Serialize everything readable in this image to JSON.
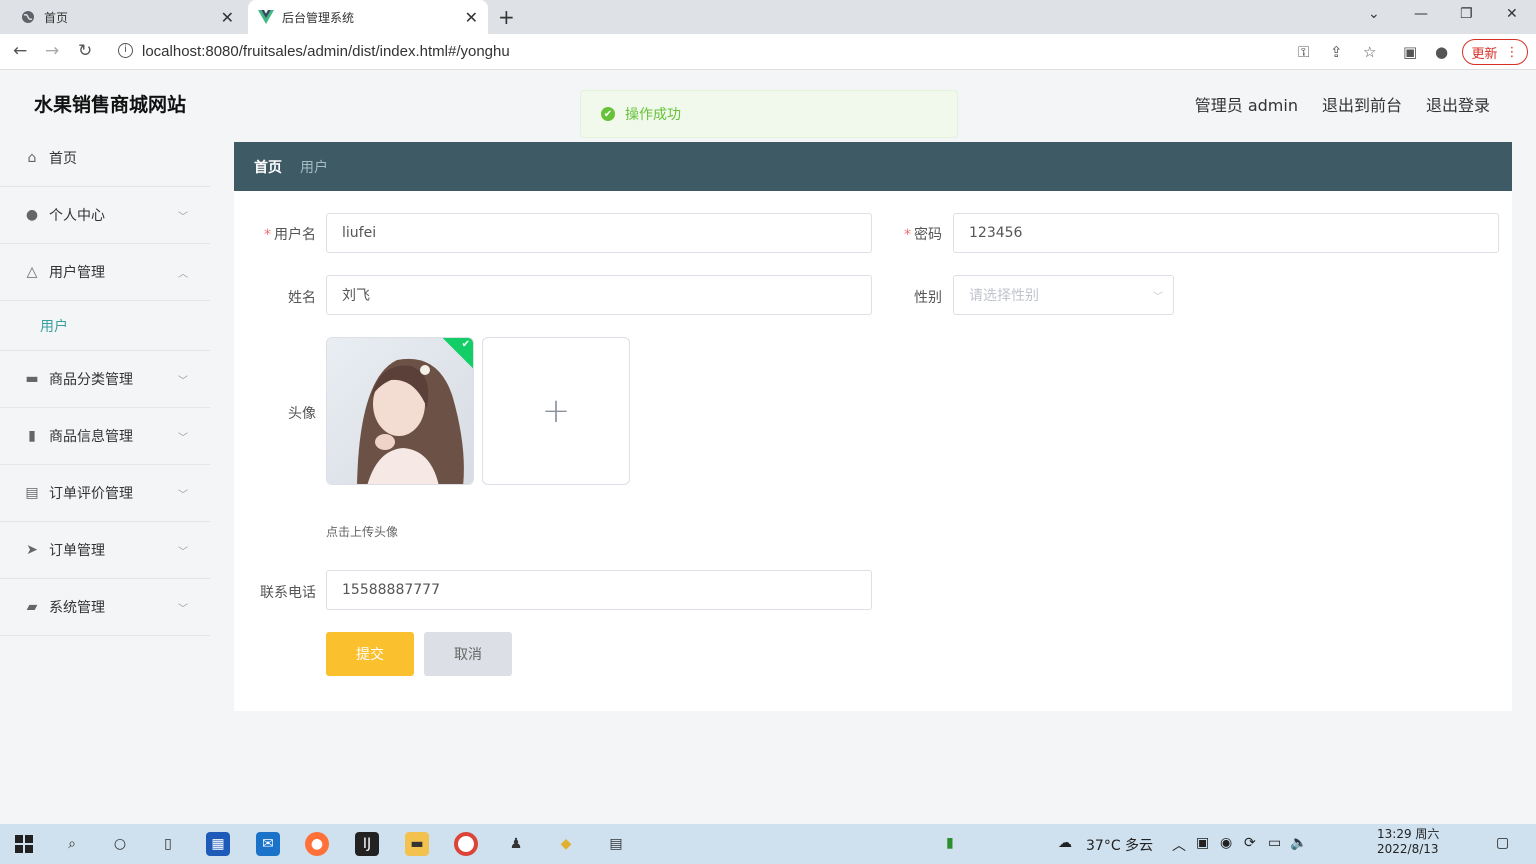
{
  "browser": {
    "tabs": [
      {
        "title": "首页",
        "active": false
      },
      {
        "title": "后台管理系统",
        "active": true
      }
    ],
    "url": "localhost:8080/fruitsales/admin/dist/index.html#/yonghu",
    "update_label": "更新"
  },
  "header": {
    "site_title": "水果销售商城网站",
    "admin_label": "管理员 admin",
    "to_frontend": "退出到前台",
    "logout": "退出登录"
  },
  "toast": {
    "message": "操作成功"
  },
  "sidebar": {
    "items": [
      {
        "label": "首页",
        "icon": "home-icon"
      },
      {
        "label": "个人中心",
        "icon": "user-icon"
      },
      {
        "label": "用户管理",
        "icon": "bell-icon"
      },
      {
        "label": "商品分类管理",
        "icon": "briefcase-icon"
      },
      {
        "label": "商品信息管理",
        "icon": "bar-chart-icon"
      },
      {
        "label": "订单评价管理",
        "icon": "clipboard-icon"
      },
      {
        "label": "订单管理",
        "icon": "paper-plane-icon"
      },
      {
        "label": "系统管理",
        "icon": "settings-icon"
      }
    ],
    "subitem": "用户"
  },
  "breadcrumb": {
    "home": "首页",
    "current": "用户"
  },
  "form": {
    "username_label": "用户名",
    "username_value": "liufei",
    "password_label": "密码",
    "password_value": "123456",
    "name_label": "姓名",
    "name_value": "刘飞",
    "gender_label": "性别",
    "gender_placeholder": "请选择性别",
    "avatar_label": "头像",
    "avatar_tip": "点击上传头像",
    "phone_label": "联系电话",
    "phone_value": "15588887777",
    "submit": "提交",
    "cancel": "取消"
  },
  "taskbar": {
    "weather": "37°C 多云",
    "time": "13:29 周六",
    "date": "2022/8/13"
  }
}
